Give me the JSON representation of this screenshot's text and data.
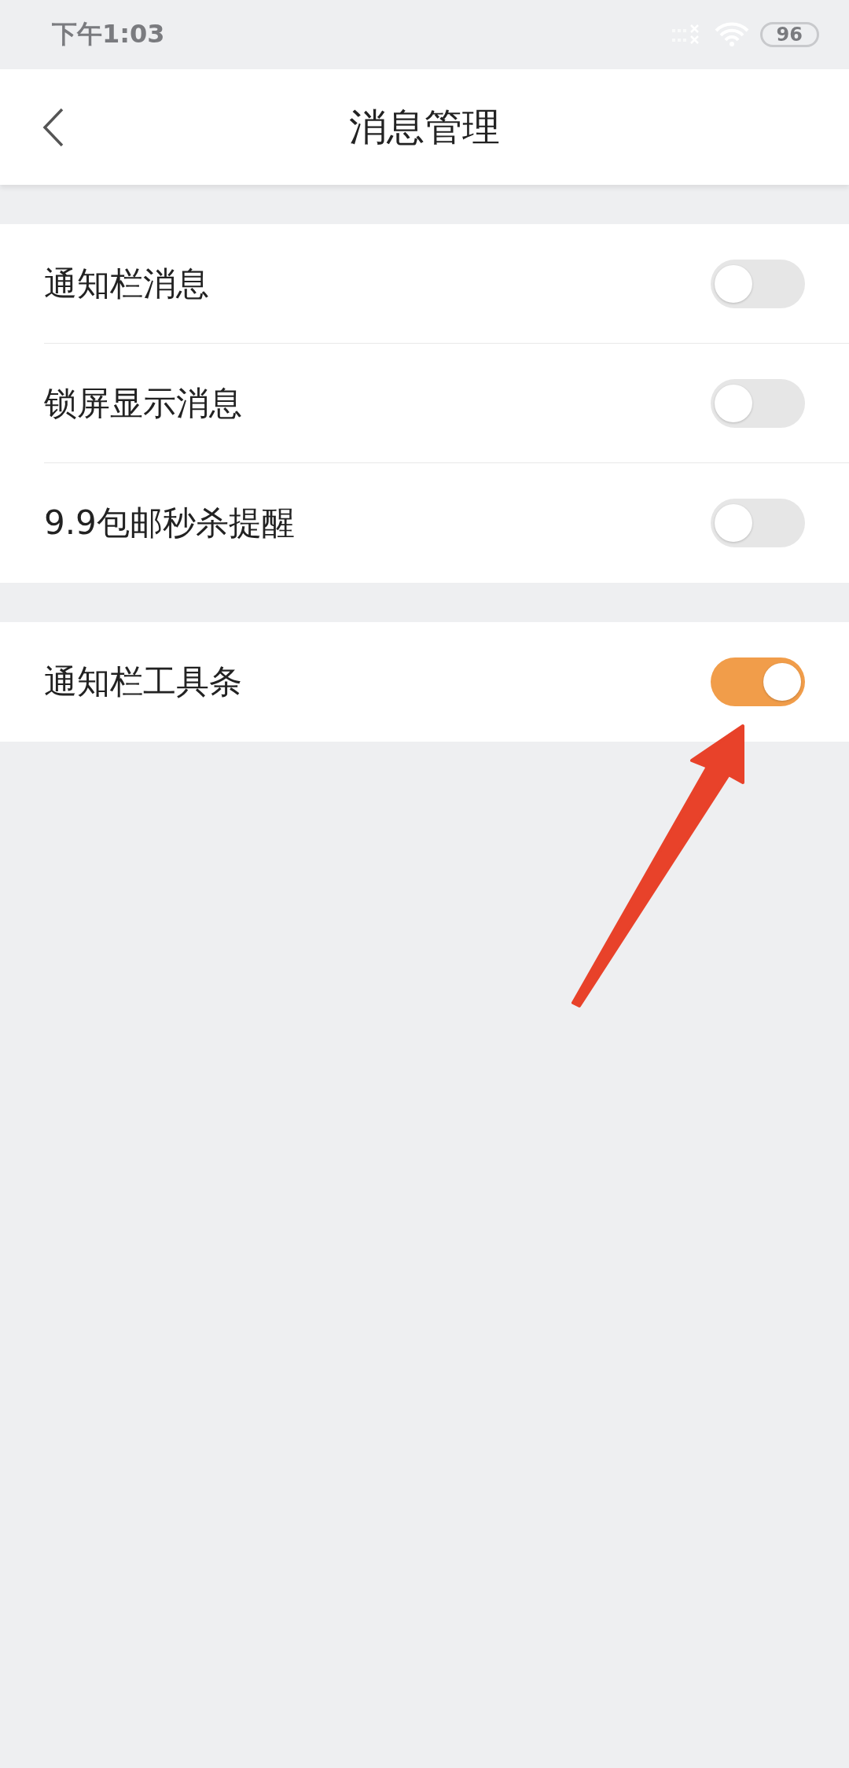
{
  "status_bar": {
    "time": "下午1:03",
    "battery": "96"
  },
  "header": {
    "title": "消息管理"
  },
  "groups": [
    {
      "items": [
        {
          "label": "通知栏消息",
          "on": false
        },
        {
          "label": "锁屏显示消息",
          "on": false
        },
        {
          "label": "9.9包邮秒杀提醒",
          "on": false
        }
      ]
    },
    {
      "items": [
        {
          "label": "通知栏工具条",
          "on": true
        }
      ]
    }
  ]
}
